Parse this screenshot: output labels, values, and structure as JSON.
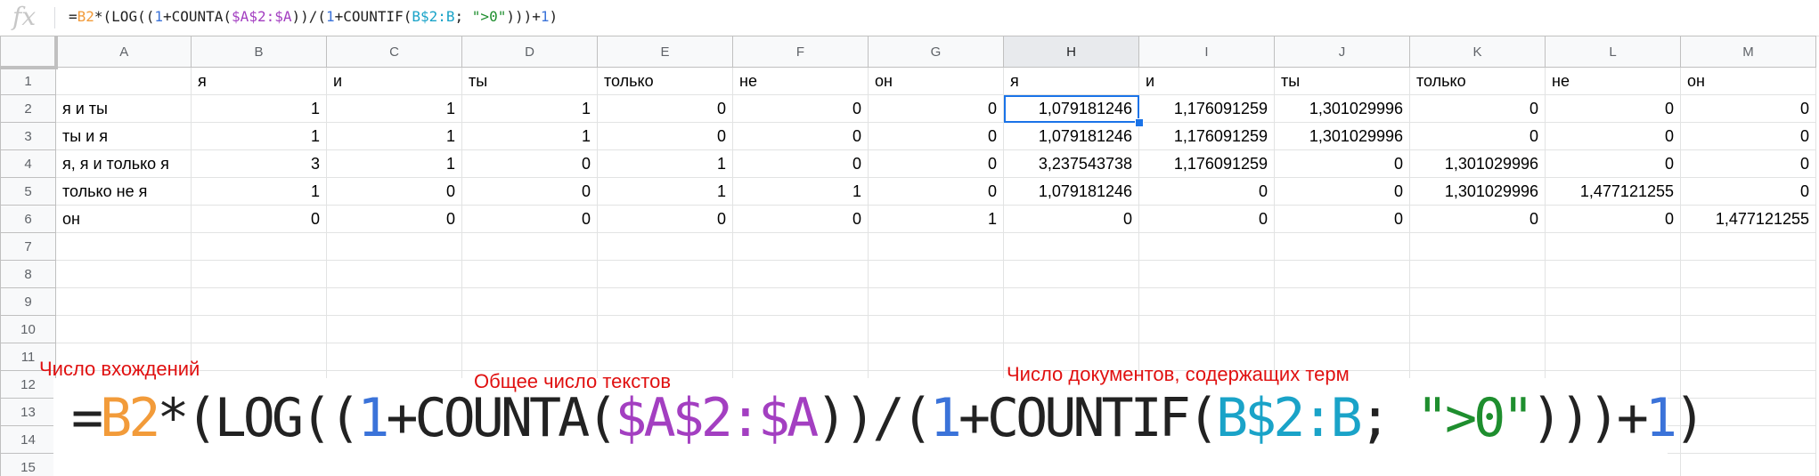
{
  "formula_bar": {
    "icon": "fx-icon",
    "icon_text": "fx",
    "segments": [
      {
        "text": "=",
        "color": "plain"
      },
      {
        "text": "B2",
        "color": "orange"
      },
      {
        "text": "*(LOG((",
        "color": "plain"
      },
      {
        "text": "1",
        "color": "blue"
      },
      {
        "text": "+COUNTA(",
        "color": "plain"
      },
      {
        "text": "$A$2:$A",
        "color": "purple"
      },
      {
        "text": "))/(",
        "color": "plain"
      },
      {
        "text": "1",
        "color": "blue"
      },
      {
        "text": "+COUNTIF(",
        "color": "plain"
      },
      {
        "text": "B$2:B",
        "color": "cyan"
      },
      {
        "text": "; ",
        "color": "plain"
      },
      {
        "text": "\">0\"",
        "color": "green"
      },
      {
        "text": ")))+",
        "color": "plain"
      },
      {
        "text": "1",
        "color": "blue"
      },
      {
        "text": ")",
        "color": "plain"
      }
    ]
  },
  "colors": {
    "orange": "#f29b3a",
    "blue": "#3b73d9",
    "purple": "#a33fc1",
    "cyan": "#1aa3c8",
    "green": "#1e8e2e",
    "annotation_red": "#e01010",
    "selection": "#1a73e8"
  },
  "sheet": {
    "column_headers": [
      "A",
      "B",
      "C",
      "D",
      "E",
      "F",
      "G",
      "H",
      "I",
      "J",
      "K",
      "L",
      "M"
    ],
    "selected_column": "H",
    "selected_cell": "H2",
    "row_numbers": [
      "1",
      "2",
      "3",
      "4",
      "5",
      "6",
      "7",
      "8",
      "9",
      "10",
      "11",
      "12",
      "13",
      "14",
      "15"
    ],
    "rows": [
      [
        "",
        "я",
        "и",
        "ты",
        "только",
        "не",
        "он",
        "я",
        "и",
        "ты",
        "только",
        "не",
        "он"
      ],
      [
        "я и ты",
        "1",
        "1",
        "1",
        "0",
        "0",
        "0",
        "1,079181246",
        "1,176091259",
        "1,301029996",
        "0",
        "0",
        "0"
      ],
      [
        "ты и я",
        "1",
        "1",
        "1",
        "0",
        "0",
        "0",
        "1,079181246",
        "1,176091259",
        "1,301029996",
        "0",
        "0",
        "0"
      ],
      [
        "я, я и только я",
        "3",
        "1",
        "0",
        "1",
        "0",
        "0",
        "3,237543738",
        "1,176091259",
        "0",
        "1,301029996",
        "0",
        "0"
      ],
      [
        "только не я",
        "1",
        "0",
        "0",
        "1",
        "1",
        "0",
        "1,079181246",
        "0",
        "0",
        "1,301029996",
        "1,477121255",
        "0"
      ],
      [
        "он",
        "0",
        "0",
        "0",
        "0",
        "0",
        "1",
        "0",
        "0",
        "0",
        "0",
        "0",
        "1,477121255"
      ]
    ]
  },
  "annotations": {
    "occurrences": "Число вхождений",
    "total_texts": "Общее число текстов",
    "docs_with_term": "Число документов, содержащих терм"
  }
}
